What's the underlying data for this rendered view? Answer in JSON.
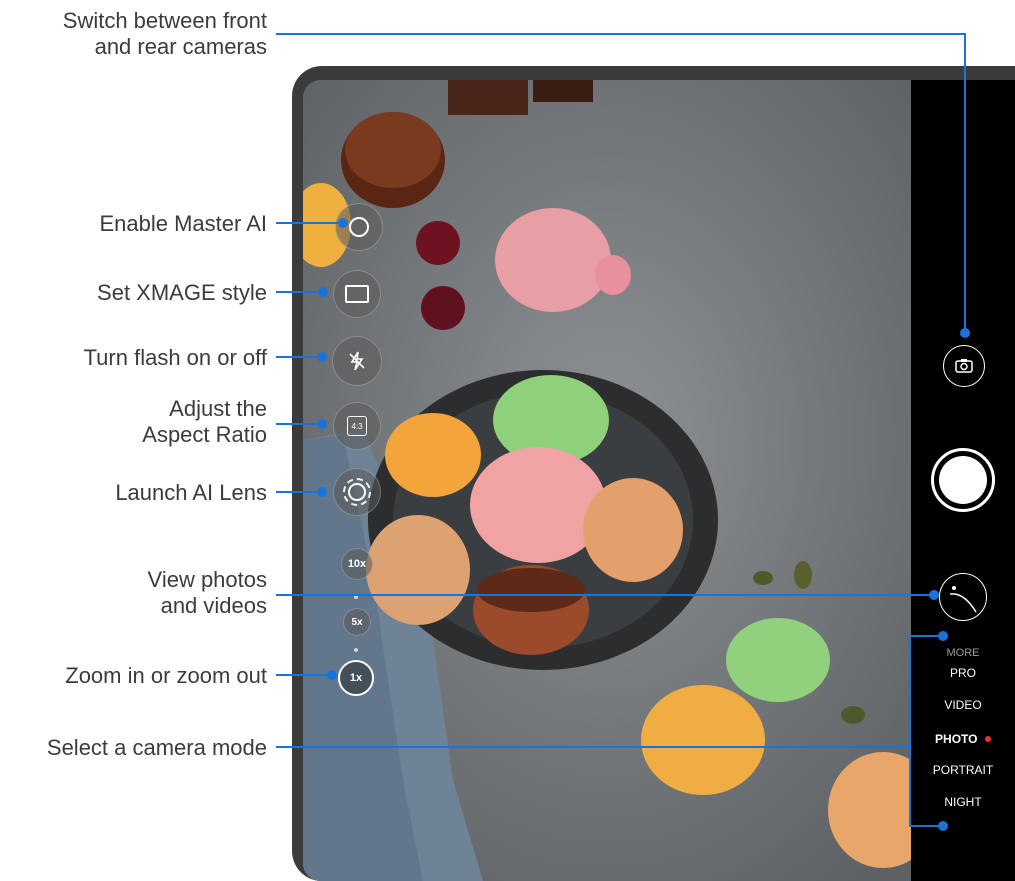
{
  "callouts": {
    "switch_cameras": [
      "Switch between front",
      "and rear cameras"
    ],
    "master_ai": "Enable Master AI",
    "xmage": "Set XMAGE style",
    "flash": "Turn flash on or off",
    "aspect": [
      "Adjust the",
      "Aspect Ratio"
    ],
    "ai_lens": "Launch AI Lens",
    "gallery": [
      "View photos",
      "and videos"
    ],
    "zoom": "Zoom in or zoom out",
    "mode": "Select a camera mode"
  },
  "controls": {
    "aspect_label": "4:3",
    "zoom_levels": [
      "10x",
      "5x",
      "1x"
    ]
  },
  "modes": {
    "more": "MORE",
    "pro": "PRO",
    "video": "VIDEO",
    "photo": "PHOTO",
    "portrait": "PORTRAIT",
    "night": "NIGHT"
  },
  "colors": {
    "leader_line": "#1a73d9",
    "record_dot": "#ff2a2a"
  }
}
